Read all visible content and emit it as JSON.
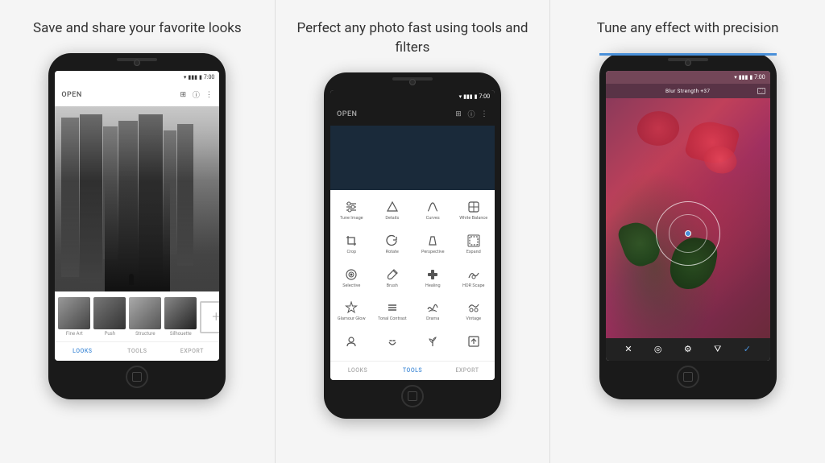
{
  "panels": [
    {
      "id": "panel-looks",
      "title": "Save and share your\nfavorite looks",
      "phone": {
        "status_time": "7:00",
        "app_bar_title": "OPEN",
        "photo_type": "bw_city",
        "looks": [
          {
            "label": "Fine Art"
          },
          {
            "label": "Push"
          },
          {
            "label": "Structure"
          },
          {
            "label": "Silhouette"
          }
        ],
        "nav_items": [
          {
            "label": "LOOKS",
            "active": true
          },
          {
            "label": "TOOLS",
            "active": false
          },
          {
            "label": "EXPORT",
            "active": false
          }
        ]
      }
    },
    {
      "id": "panel-tools",
      "title": "Perfect any photo fast\nusing tools and filters",
      "phone": {
        "status_time": "7:00",
        "app_bar_title": "OPEN",
        "tools": [
          {
            "label": "Tune Image",
            "icon": "⚡"
          },
          {
            "label": "Details",
            "icon": "▽"
          },
          {
            "label": "Curves",
            "icon": "~"
          },
          {
            "label": "White Balance",
            "icon": "◈"
          },
          {
            "label": "Crop",
            "icon": "⊡"
          },
          {
            "label": "Rotate",
            "icon": "↻"
          },
          {
            "label": "Perspective",
            "icon": "⬡"
          },
          {
            "label": "Expand",
            "icon": "⊞"
          },
          {
            "label": "Selective",
            "icon": "◎"
          },
          {
            "label": "Brush",
            "icon": "✎"
          },
          {
            "label": "Healing",
            "icon": "✚"
          },
          {
            "label": "HDR Scape",
            "icon": "☁"
          },
          {
            "label": "Glamour Glow",
            "icon": "✦"
          },
          {
            "label": "Tonal Contrast",
            "icon": "≡"
          },
          {
            "label": "Drama",
            "icon": "☁"
          },
          {
            "label": "Vintage",
            "icon": "☁"
          },
          {
            "label": "Head",
            "icon": "☻"
          },
          {
            "label": "Face",
            "icon": "〜"
          },
          {
            "label": "Plant",
            "icon": "❧"
          },
          {
            "label": "Export",
            "icon": "⊡"
          }
        ],
        "nav_items": [
          {
            "label": "LOOKS",
            "active": false
          },
          {
            "label": "TOOLS",
            "active": true
          },
          {
            "label": "EXPORT",
            "active": false
          }
        ]
      }
    },
    {
      "id": "panel-precision",
      "title": "Tune any effect with\nprecision",
      "phone": {
        "status_time": "7:00",
        "header_label": "Blur Strength +37",
        "photo_type": "flowers"
      }
    }
  ],
  "accent_color": "#4a90d9",
  "bg_color": "#f5f5f5"
}
